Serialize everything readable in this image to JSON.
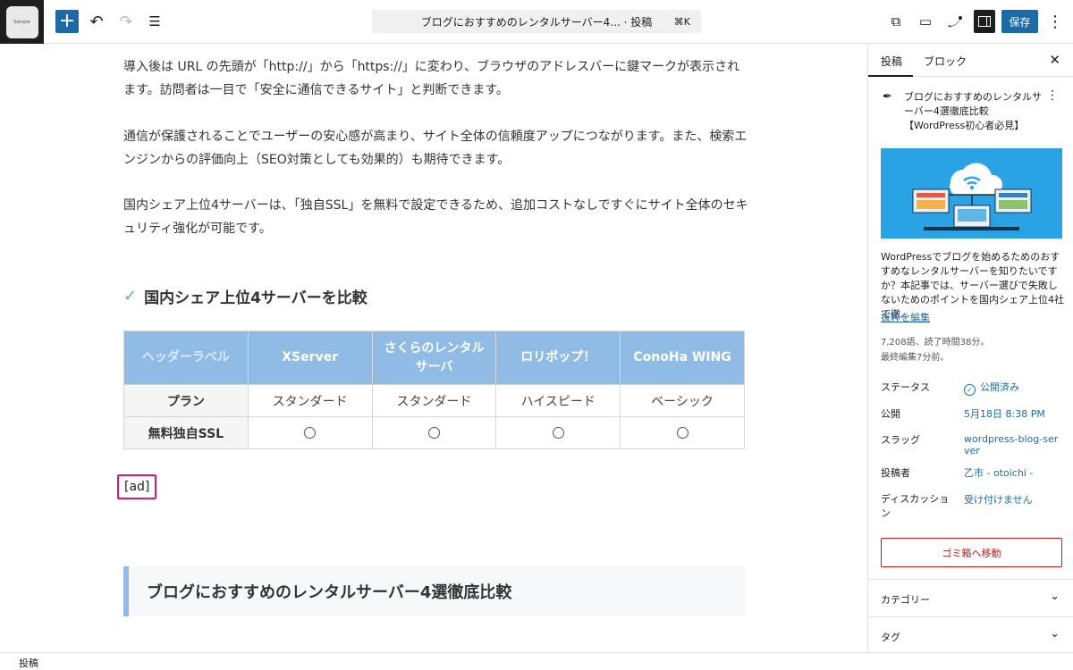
{
  "toolbar": {
    "logo_text": "Sample",
    "add_icon": "+",
    "undo_icon": "↶",
    "redo_icon": "↷",
    "list_view_icon": "☰",
    "document_title": "ブログにおすすめのレンタルサーバー4... · 投稿",
    "shortcut": "⌘K",
    "view_post_icon": "⧉",
    "preview_icon": "▭",
    "save_label": "保存",
    "options_icon": "⋮"
  },
  "content": {
    "para1": "導入後は URL の先頭が「http://」から「https://」に変わり、ブラウザのアドレスバーに鍵マークが表示されます。訪問者は一目で「安全に通信できるサイト」と判断できます。",
    "para2": "通信が保護されることでユーザーの安心感が高まり、サイト全体の信頼度アップにつながります。また、検索エンジンからの評価向上（SEO対策としても効果的）も期待できます。",
    "para3": "国内シェア上位4サーバーは、「独自SSL」を無料で設定できるため、追加コストなしですぐにサイト全体のセキュリティ強化が可能です。",
    "heading3": "国内シェア上位4サーバーを比較",
    "heading3_icon": "✓",
    "table": {
      "headers": [
        "ヘッダーラベル",
        "XServer",
        "さくらのレンタルサーバ",
        "ロリポップ！",
        "ConoHa WING"
      ],
      "rows": [
        [
          "プラン",
          "スタンダード",
          "スタンダード",
          "ハイスピード",
          "ベーシック"
        ],
        [
          "無料独自SSL",
          "○",
          "○",
          "○",
          "○"
        ]
      ]
    },
    "shortcode": "[ad]",
    "heading2": "ブログにおすすめのレンタルサーバー4選徹底比較"
  },
  "sidebar": {
    "tab_post": "投稿",
    "tab_block": "ブロック",
    "close_icon": "✕",
    "post_icon": "✒",
    "post_title": "ブログにおすすめのレンタルサーバー4選徹底比較【WordPress初心者必見】",
    "kebab_icon": "⋮",
    "excerpt": "WordPressでブログを始めるためのおすすめなレンタルサーバーを知りたいですか？本記事では、サーバー選びで失敗しないためのポイントを国内シェア上位4社で徹...",
    "excerpt_link": "抜粋を編集",
    "meta_words": "7,208語、読了時間38分。",
    "meta_edited": "最終編集7分前。",
    "status_label": "ステータス",
    "status_value": "公開済み",
    "publish_label": "公開",
    "publish_value": "5月18日 8:38 PM",
    "slug_label": "スラッグ",
    "slug_value": "wordpress-blog-server",
    "author_label": "投稿者",
    "author_value": "乙市 - otoichi -",
    "discussion_label": "ディスカッション",
    "discussion_value": "受け付けません",
    "trash_label": "ゴミ箱へ移動",
    "category_label": "カテゴリー",
    "tag_label": "タグ",
    "chevron_icon": "⌄"
  },
  "footer": {
    "breadcrumb": "投稿"
  }
}
